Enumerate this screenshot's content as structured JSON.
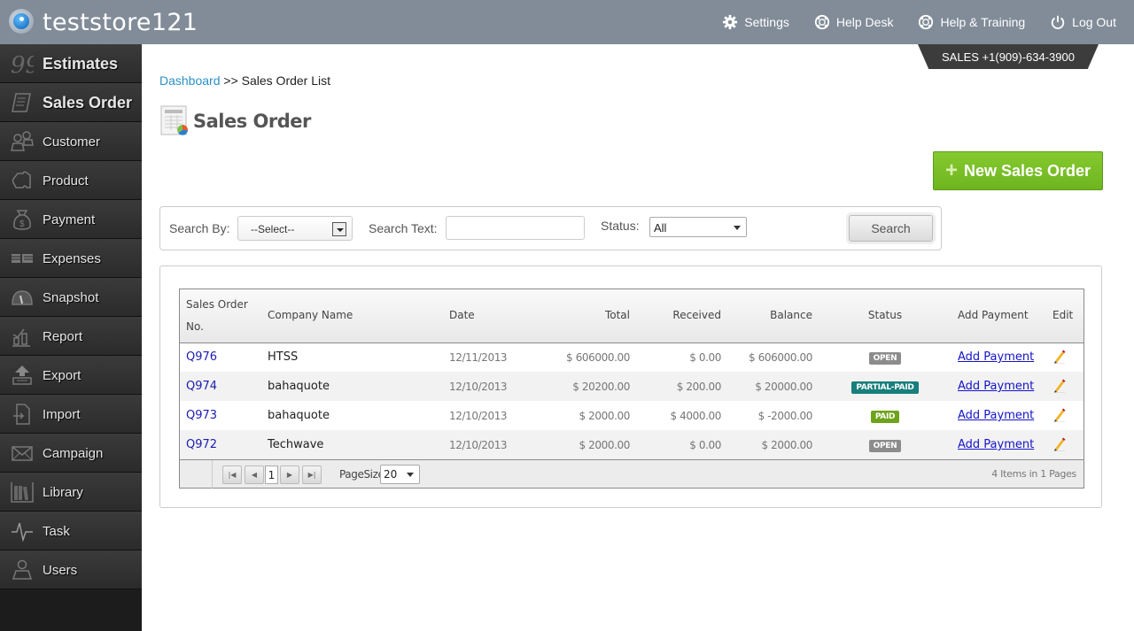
{
  "app": {
    "store_name": "teststore121"
  },
  "topnav": {
    "items": [
      {
        "label": "Settings",
        "icon": "gear-icon"
      },
      {
        "label": "Help Desk",
        "icon": "lifebuoy-icon"
      },
      {
        "label": "Help & Training",
        "icon": "lifebuoy-icon"
      },
      {
        "label": "Log Out",
        "icon": "power-icon"
      }
    ],
    "sales_phone": "SALES +1(909)-634-3900"
  },
  "sidebar": {
    "items": [
      {
        "label": "Estimates",
        "icon": "quote-icon"
      },
      {
        "label": "Sales Order",
        "icon": "receipt-icon"
      },
      {
        "label": "Customer",
        "icon": "customers-icon"
      },
      {
        "label": "Product",
        "icon": "puzzle-icon"
      },
      {
        "label": "Payment",
        "icon": "money-bag-icon"
      },
      {
        "label": "Expenses",
        "icon": "cash-stack-icon"
      },
      {
        "label": "Snapshot",
        "icon": "gauge-icon"
      },
      {
        "label": "Report",
        "icon": "bar-chart-icon"
      },
      {
        "label": "Export",
        "icon": "upload-icon"
      },
      {
        "label": "Import",
        "icon": "import-file-icon"
      },
      {
        "label": "Campaign",
        "icon": "envelope-icon"
      },
      {
        "label": "Library",
        "icon": "books-icon"
      },
      {
        "label": "Task",
        "icon": "pulse-icon"
      },
      {
        "label": "Users",
        "icon": "user-icon"
      }
    ]
  },
  "breadcrumb": {
    "link": "Dashboard",
    "separator": ">>",
    "current": "Sales Order List"
  },
  "page": {
    "title": "Sales Order",
    "new_button": "New Sales Order"
  },
  "search": {
    "search_by_label": "Search By:",
    "search_by_value": "--Select--",
    "search_text_label": "Search Text:",
    "search_text_value": "",
    "status_label": "Status:",
    "status_value": "All",
    "search_button": "Search"
  },
  "grid": {
    "columns": [
      "Sales Order No.",
      "Company Name",
      "Date",
      "Total",
      "Received",
      "Balance",
      "Status",
      "Add Payment",
      "Edit"
    ],
    "column_header_first_line1": "Sales Order",
    "column_header_first_line2": "No.",
    "rows": [
      {
        "so": "Q976",
        "company": "HTSS",
        "date": "12/11/2013",
        "total": "$ 606000.00",
        "received": "$ 0.00",
        "balance": "$ 606000.00",
        "status": "OPEN",
        "status_color": "#8c8c8c",
        "action": "Add Payment"
      },
      {
        "so": "Q974",
        "company": "bahaquote",
        "date": "12/10/2013",
        "total": "$ 20200.00",
        "received": "$ 200.00",
        "balance": "$ 20000.00",
        "status": "PARTIAL-PAID",
        "status_color": "#177f7c",
        "action": "Add Payment"
      },
      {
        "so": "Q973",
        "company": "bahaquote",
        "date": "12/10/2013",
        "total": "$ 2000.00",
        "received": "$ 4000.00",
        "balance": "$ -2000.00",
        "status": "PAID",
        "status_color": "#6fa31a",
        "action": "Add Payment"
      },
      {
        "so": "Q972",
        "company": "Techwave",
        "date": "12/10/2013",
        "total": "$ 2000.00",
        "received": "$ 0.00",
        "balance": "$ 2000.00",
        "status": "OPEN",
        "status_color": "#8c8c8c",
        "action": "Add Payment"
      }
    ],
    "pager": {
      "current_page": "1",
      "page_size_label": "PageSize",
      "page_size": "20",
      "info": "4 Items in 1 Pages"
    }
  }
}
